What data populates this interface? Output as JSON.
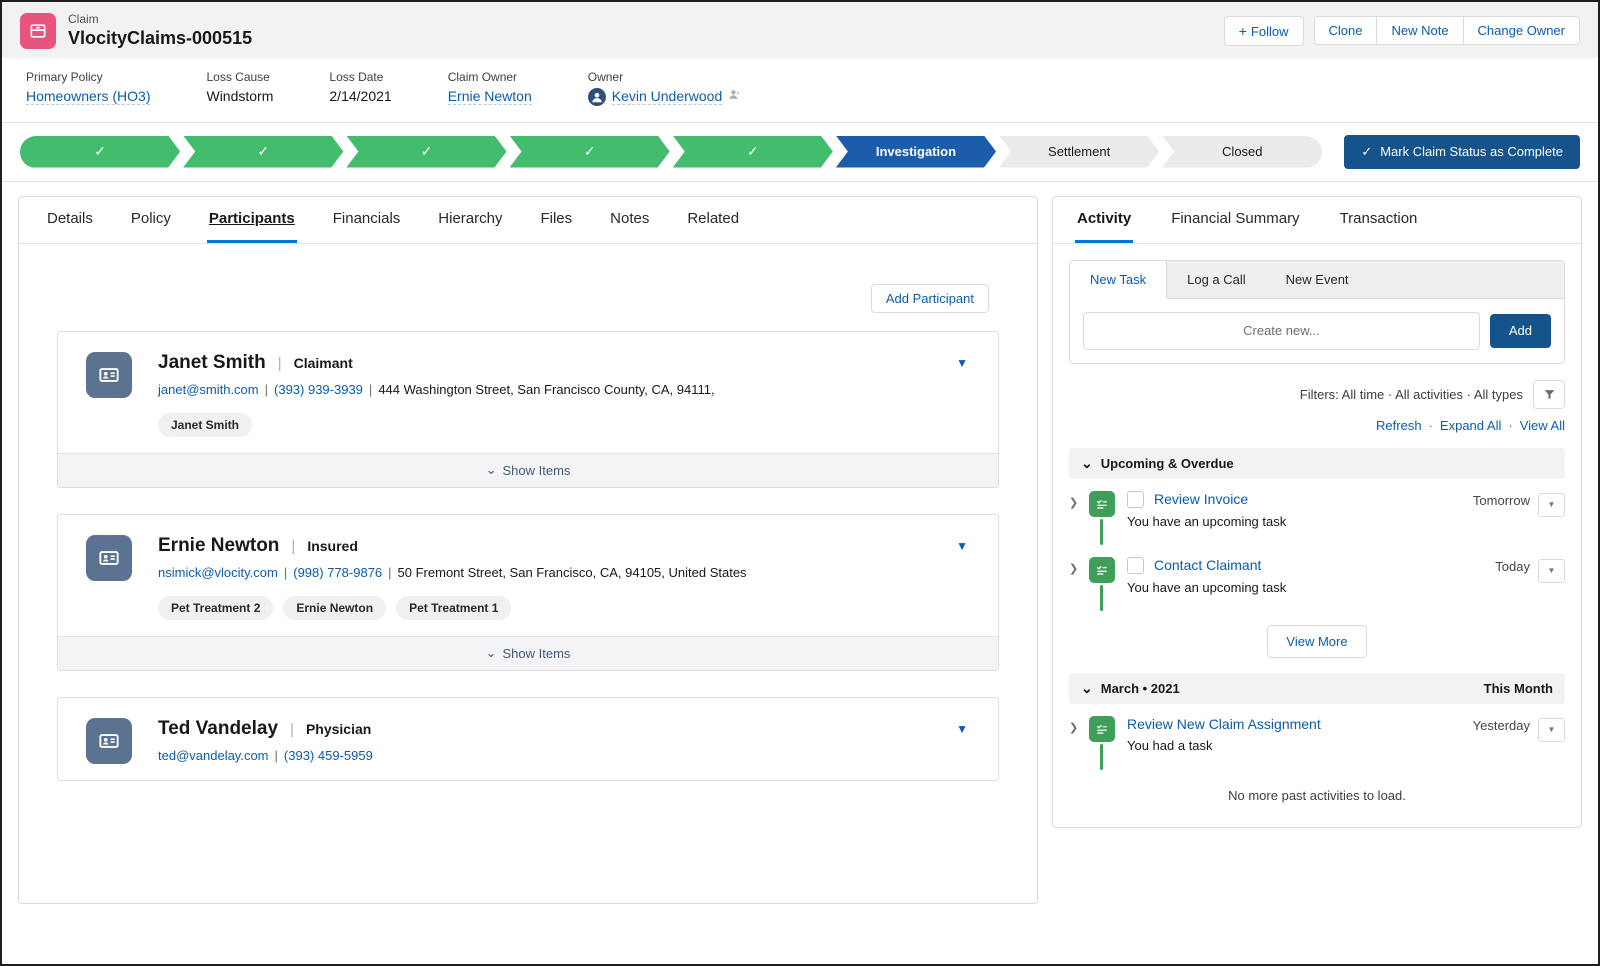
{
  "icons": {
    "plus": "+",
    "check": "✓",
    "dropdown_triangle": "▼",
    "chevron_right": "❯",
    "chevron_down": "⌄"
  },
  "colors": {
    "path_complete_green": "#43bd6d",
    "path_current_blue": "#1b5cab",
    "brand_link_blue": "#0b5cab",
    "dark_button_blue": "#14538c",
    "task_icon_green": "#3f9e58",
    "claim_icon_pink": "#e8547c",
    "avatar_slate": "#5b7390"
  },
  "header": {
    "record_type": "Claim",
    "title": "VlocityClaims-000515",
    "follow_label": "Follow",
    "actions": [
      "Clone",
      "New Note",
      "Change Owner"
    ],
    "fields": [
      {
        "label": "Primary Policy",
        "value": "Homeowners (HO3)"
      },
      {
        "label": "Loss Cause",
        "value": "Windstorm"
      },
      {
        "label": "Loss Date",
        "value": "2/14/2021"
      },
      {
        "label": "Claim Owner",
        "value": "Ernie Newton"
      },
      {
        "label": "Owner",
        "value": "Kevin Underwood"
      }
    ]
  },
  "path": {
    "stages": [
      {
        "label": "",
        "state": "complete"
      },
      {
        "label": "",
        "state": "complete"
      },
      {
        "label": "",
        "state": "complete"
      },
      {
        "label": "",
        "state": "complete"
      },
      {
        "label": "",
        "state": "complete"
      },
      {
        "label": "Investigation",
        "state": "current"
      },
      {
        "label": "Settlement",
        "state": "incomplete"
      },
      {
        "label": "Closed",
        "state": "incomplete"
      }
    ],
    "mark_complete_label": "Mark Claim Status as Complete"
  },
  "main_tabs": [
    {
      "label": "Details"
    },
    {
      "label": "Policy"
    },
    {
      "label": "Participants"
    },
    {
      "label": "Financials"
    },
    {
      "label": "Hierarchy"
    },
    {
      "label": "Files"
    },
    {
      "label": "Notes"
    },
    {
      "label": "Related"
    }
  ],
  "participants": {
    "add_button": "Add Participant",
    "show_items_label": "Show Items",
    "cards": [
      {
        "name": "Janet Smith",
        "role": "Claimant",
        "email": "janet@smith.com",
        "phone": "(393) 939-3939",
        "address": "444 Washington Street, San Francisco County, CA, 94111,",
        "tags": [
          "Janet Smith"
        ]
      },
      {
        "name": "Ernie Newton",
        "role": "Insured",
        "email": "nsimick@vlocity.com",
        "phone": "(998) 778-9876",
        "address": "50 Fremont Street, San Francisco, CA, 94105, United States",
        "tags": [
          "Pet Treatment 2",
          "Ernie Newton",
          "Pet Treatment 1"
        ]
      },
      {
        "name": "Ted Vandelay",
        "role": "Physician",
        "email": "ted@vandelay.com",
        "phone": "(393) 459-5959",
        "address": "",
        "tags": []
      }
    ]
  },
  "activity_panel": {
    "tabs": [
      {
        "label": "Activity"
      },
      {
        "label": "Financial Summary"
      },
      {
        "label": "Transaction"
      }
    ],
    "composer_tabs": [
      {
        "label": "New Task"
      },
      {
        "label": "Log a Call"
      },
      {
        "label": "New Event"
      }
    ],
    "input_placeholder": "Create new...",
    "add_button": "Add",
    "filters_text": "Filters: All time · All activities · All types",
    "links": [
      {
        "label": "Refresh"
      },
      {
        "label": "Expand All"
      },
      {
        "label": "View All"
      }
    ],
    "sections": [
      {
        "title": "Upcoming & Overdue",
        "right_label": "",
        "items": [
          {
            "title": "Review Invoice",
            "date": "Tomorrow",
            "desc": "You have an upcoming task"
          },
          {
            "title": "Contact Claimant",
            "date": "Today",
            "desc": "You have an upcoming task"
          }
        ],
        "footer_button": "View More"
      },
      {
        "title": "March • 2021",
        "right_label": "This Month",
        "items": [
          {
            "title": "Review New Claim Assignment",
            "date": "Yesterday",
            "desc": "You had a task"
          }
        ],
        "footer_text": "No more past activities to load."
      }
    ]
  }
}
